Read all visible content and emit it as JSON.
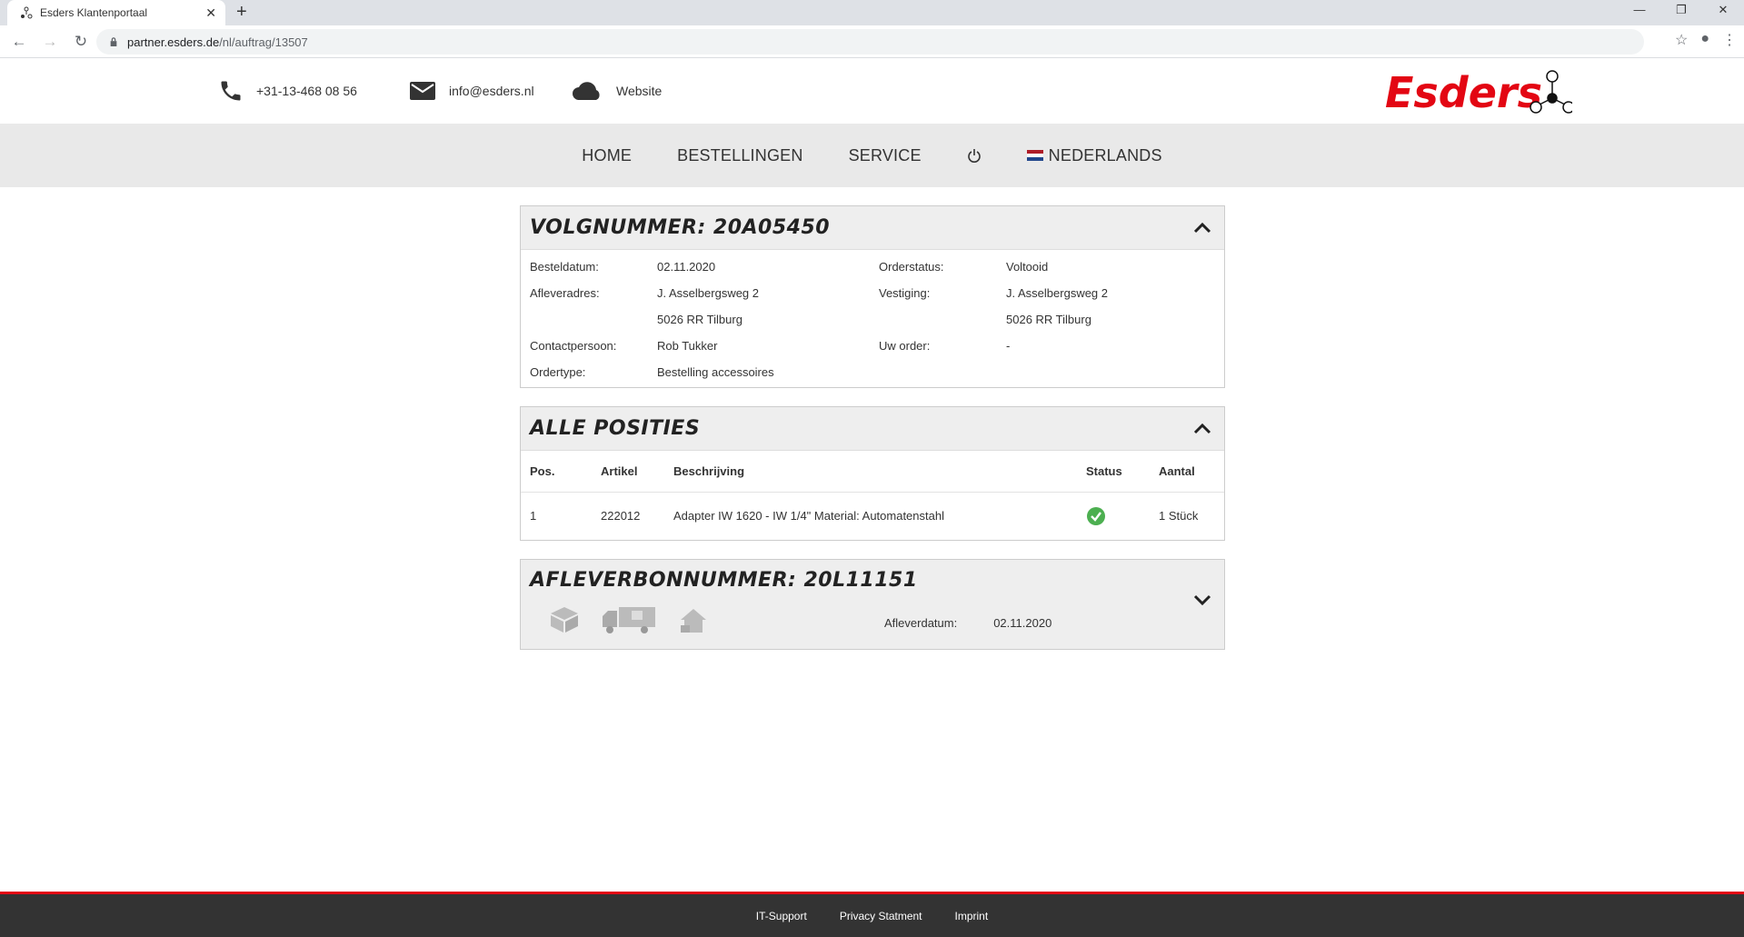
{
  "browser": {
    "tab_title": "Esders Klantenportaal",
    "url_host": "partner.esders.de",
    "url_path": "/nl/auftrag/13507"
  },
  "contact": {
    "phone": "+31-13-468 08 56",
    "email": "info@esders.nl",
    "website": "Website"
  },
  "logo_text": "Esders",
  "nav": {
    "home": "HOME",
    "orders": "BESTELLINGEN",
    "service": "SERVICE",
    "language": "NEDERLANDS"
  },
  "order": {
    "title": "VOLGNUMMER: 20A05450",
    "labels": {
      "order_date": "Besteldatum:",
      "delivery_address": "Afleveradres:",
      "contact_person": "Contactpersoon:",
      "order_type": "Ordertype:",
      "order_status": "Orderstatus:",
      "branch": "Vestiging:",
      "your_order": "Uw order:"
    },
    "values": {
      "order_date": "02.11.2020",
      "delivery_street": "J. Asselbergsweg 2",
      "delivery_city": "5026 RR Tilburg",
      "contact_person": "Rob Tukker",
      "order_type": "Bestelling accessoires",
      "order_status": "Voltooid",
      "branch_street": "J. Asselbergsweg 2",
      "branch_city": "5026 RR Tilburg",
      "your_order": "-"
    }
  },
  "positions": {
    "title": "ALLE POSITIES",
    "columns": [
      "Pos.",
      "Artikel",
      "Beschrijving",
      "Status",
      "Aantal"
    ],
    "rows": [
      {
        "pos": "1",
        "article": "222012",
        "description": "Adapter IW 1620 - IW 1/4\" Material: Automatenstahl",
        "status": "check-circle-icon",
        "quantity": "1 Stück"
      }
    ]
  },
  "delivery": {
    "title": "AFLEVERBONNUMMER: 20L11151",
    "date_label": "Afleverdatum:",
    "date_value": "02.11.2020"
  },
  "footer": {
    "it_support": "IT-Support",
    "privacy": "Privacy Statment",
    "imprint": "Imprint"
  },
  "colors": {
    "brand_red": "#e30613",
    "status_green": "#4caf50",
    "footer_bg": "#333333",
    "nav_bg": "#e9e9e9"
  }
}
